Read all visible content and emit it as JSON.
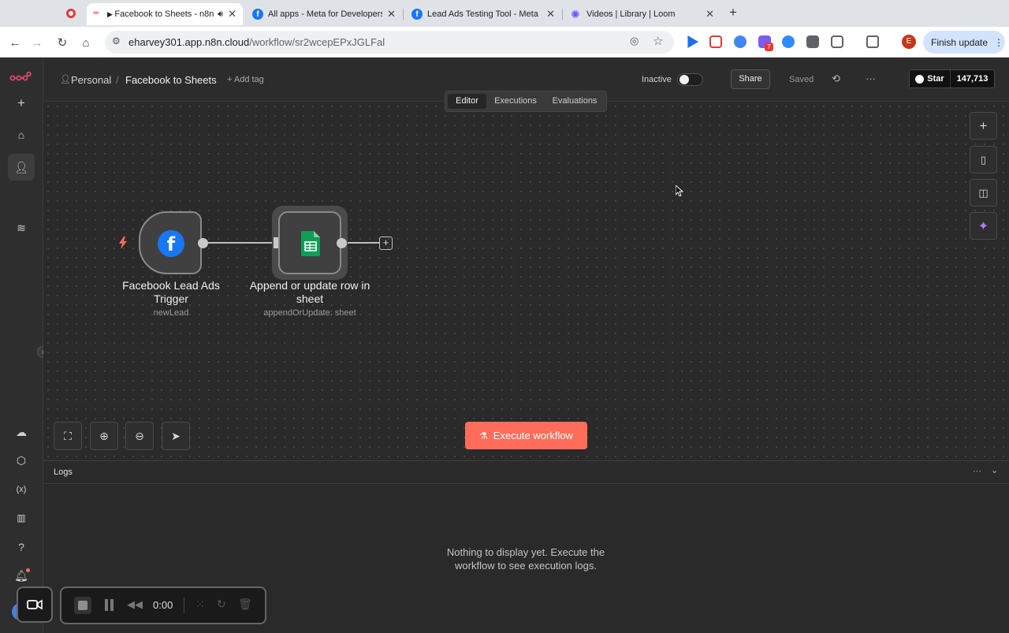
{
  "browser": {
    "tabs": [
      {
        "label": "Facebook to Sheets - n8n",
        "active": true
      },
      {
        "label": "All apps - Meta for Developers",
        "active": false
      },
      {
        "label": "Lead Ads Testing Tool - Meta",
        "active": false
      },
      {
        "label": "Videos | Library | Loom",
        "active": false
      }
    ],
    "new_tab": "+",
    "url_host": "eharvey301.app.n8n.cloud",
    "url_path": "/workflow/sr2wcepEPxJGLFal",
    "finish_update": "Finish update",
    "profile_initial": "E",
    "ext_badge": "7"
  },
  "header": {
    "project": "Personal",
    "separator": "/",
    "workflow_name": "Facebook to Sheets",
    "add_tag": "+ Add tag",
    "status_label": "Inactive",
    "share": "Share",
    "saved": "Saved",
    "more": "···",
    "github_star": "Star",
    "github_count": "147,713",
    "tabs": [
      "Editor",
      "Executions",
      "Evaluations"
    ]
  },
  "nodes": [
    {
      "title_line1": "Facebook Lead Ads",
      "title_line2": "Trigger",
      "subtitle": "newLead"
    },
    {
      "title_line1": "Append or update row in",
      "title_line2": "sheet",
      "subtitle": "appendOrUpdate: sheet"
    }
  ],
  "canvas": {
    "execute_button": "Execute workflow"
  },
  "logs": {
    "title": "Logs",
    "empty_line1": "Nothing to display yet. Execute the",
    "empty_line2": "workflow to see execution logs.",
    "more": "···"
  },
  "recorder": {
    "time": "0:00"
  },
  "colors": {
    "accent": "#ff6d5a",
    "sheets_green": "#0f9d58",
    "facebook_blue": "#1877f2"
  }
}
